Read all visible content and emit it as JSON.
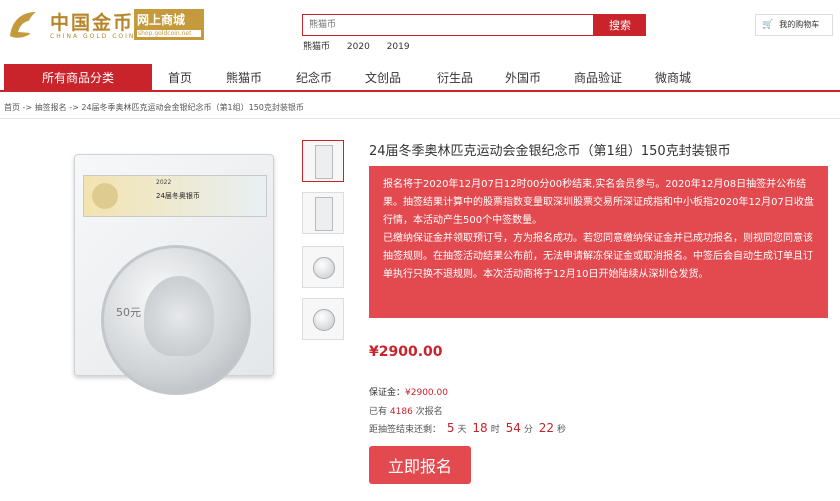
{
  "logo": {
    "brand_cn": "中国金币",
    "brand_en": "CHINA GOLD COIN",
    "shop_cn": "网上商城",
    "shop_url": "shop.goldcoin.net"
  },
  "search": {
    "placeholder": "熊猫币",
    "button": "搜索",
    "hot": [
      "熊猫币",
      "2020",
      "2019"
    ]
  },
  "cart": {
    "icon": "cart-icon",
    "label": "我的购物车"
  },
  "nav": {
    "all": "所有商品分类",
    "items": [
      "首页",
      "熊猫币",
      "纪念币",
      "文创品",
      "衍生品",
      "外国币",
      "商品验证",
      "微商城"
    ]
  },
  "breadcrumb": "首页 -> 抽签报名 -> 24届冬季奥林匹克运动会金银纪念币（第1组）150克封装银币",
  "product": {
    "title": "24届冬季奥林匹克运动会金银纪念币（第1组）150克封装银币",
    "slab_year": "2022",
    "slab_name": "24届冬奥银币",
    "coin_face": "50元",
    "notice": [
      "报名将于2020年12月07日12时00分00秒结束,实名会员参与。2020年12月08日抽签并公布结果。抽签结果计算中的股票指数变量取深圳股票交易所深证成指和中小板指2020年12月07日收盘行情，本活动产生500个中签数量。",
      "已缴纳保证金并领取预订号，方为报名成功。若您同意缴纳保证金并已成功报名，则视同您同意该抽签规则。在抽签活动结果公布前，无法申请解冻保证金或取消报名。中签后会自动生成订单且订单执行只换不退规则。本次活动商将于12月10日开始陆续从深圳仓发货。"
    ],
    "price": "¥2900.00",
    "deposit_label": "保证金：",
    "deposit_value": "¥2900.00",
    "subs_prefix": "已有",
    "subs_count": "4186",
    "subs_suffix": "次报名",
    "countdown_label": "距抽签结束还剩：",
    "countdown": {
      "days": "5",
      "hours": "18",
      "minutes": "54",
      "seconds": "22"
    },
    "countdown_units": {
      "days": "天",
      "hours": "时",
      "minutes": "分",
      "seconds": "秒"
    },
    "signup": "立即报名"
  },
  "colors": {
    "brand_red": "#c9232b",
    "notice_bg": "#e24a4f",
    "gold": "#c59a3c"
  }
}
